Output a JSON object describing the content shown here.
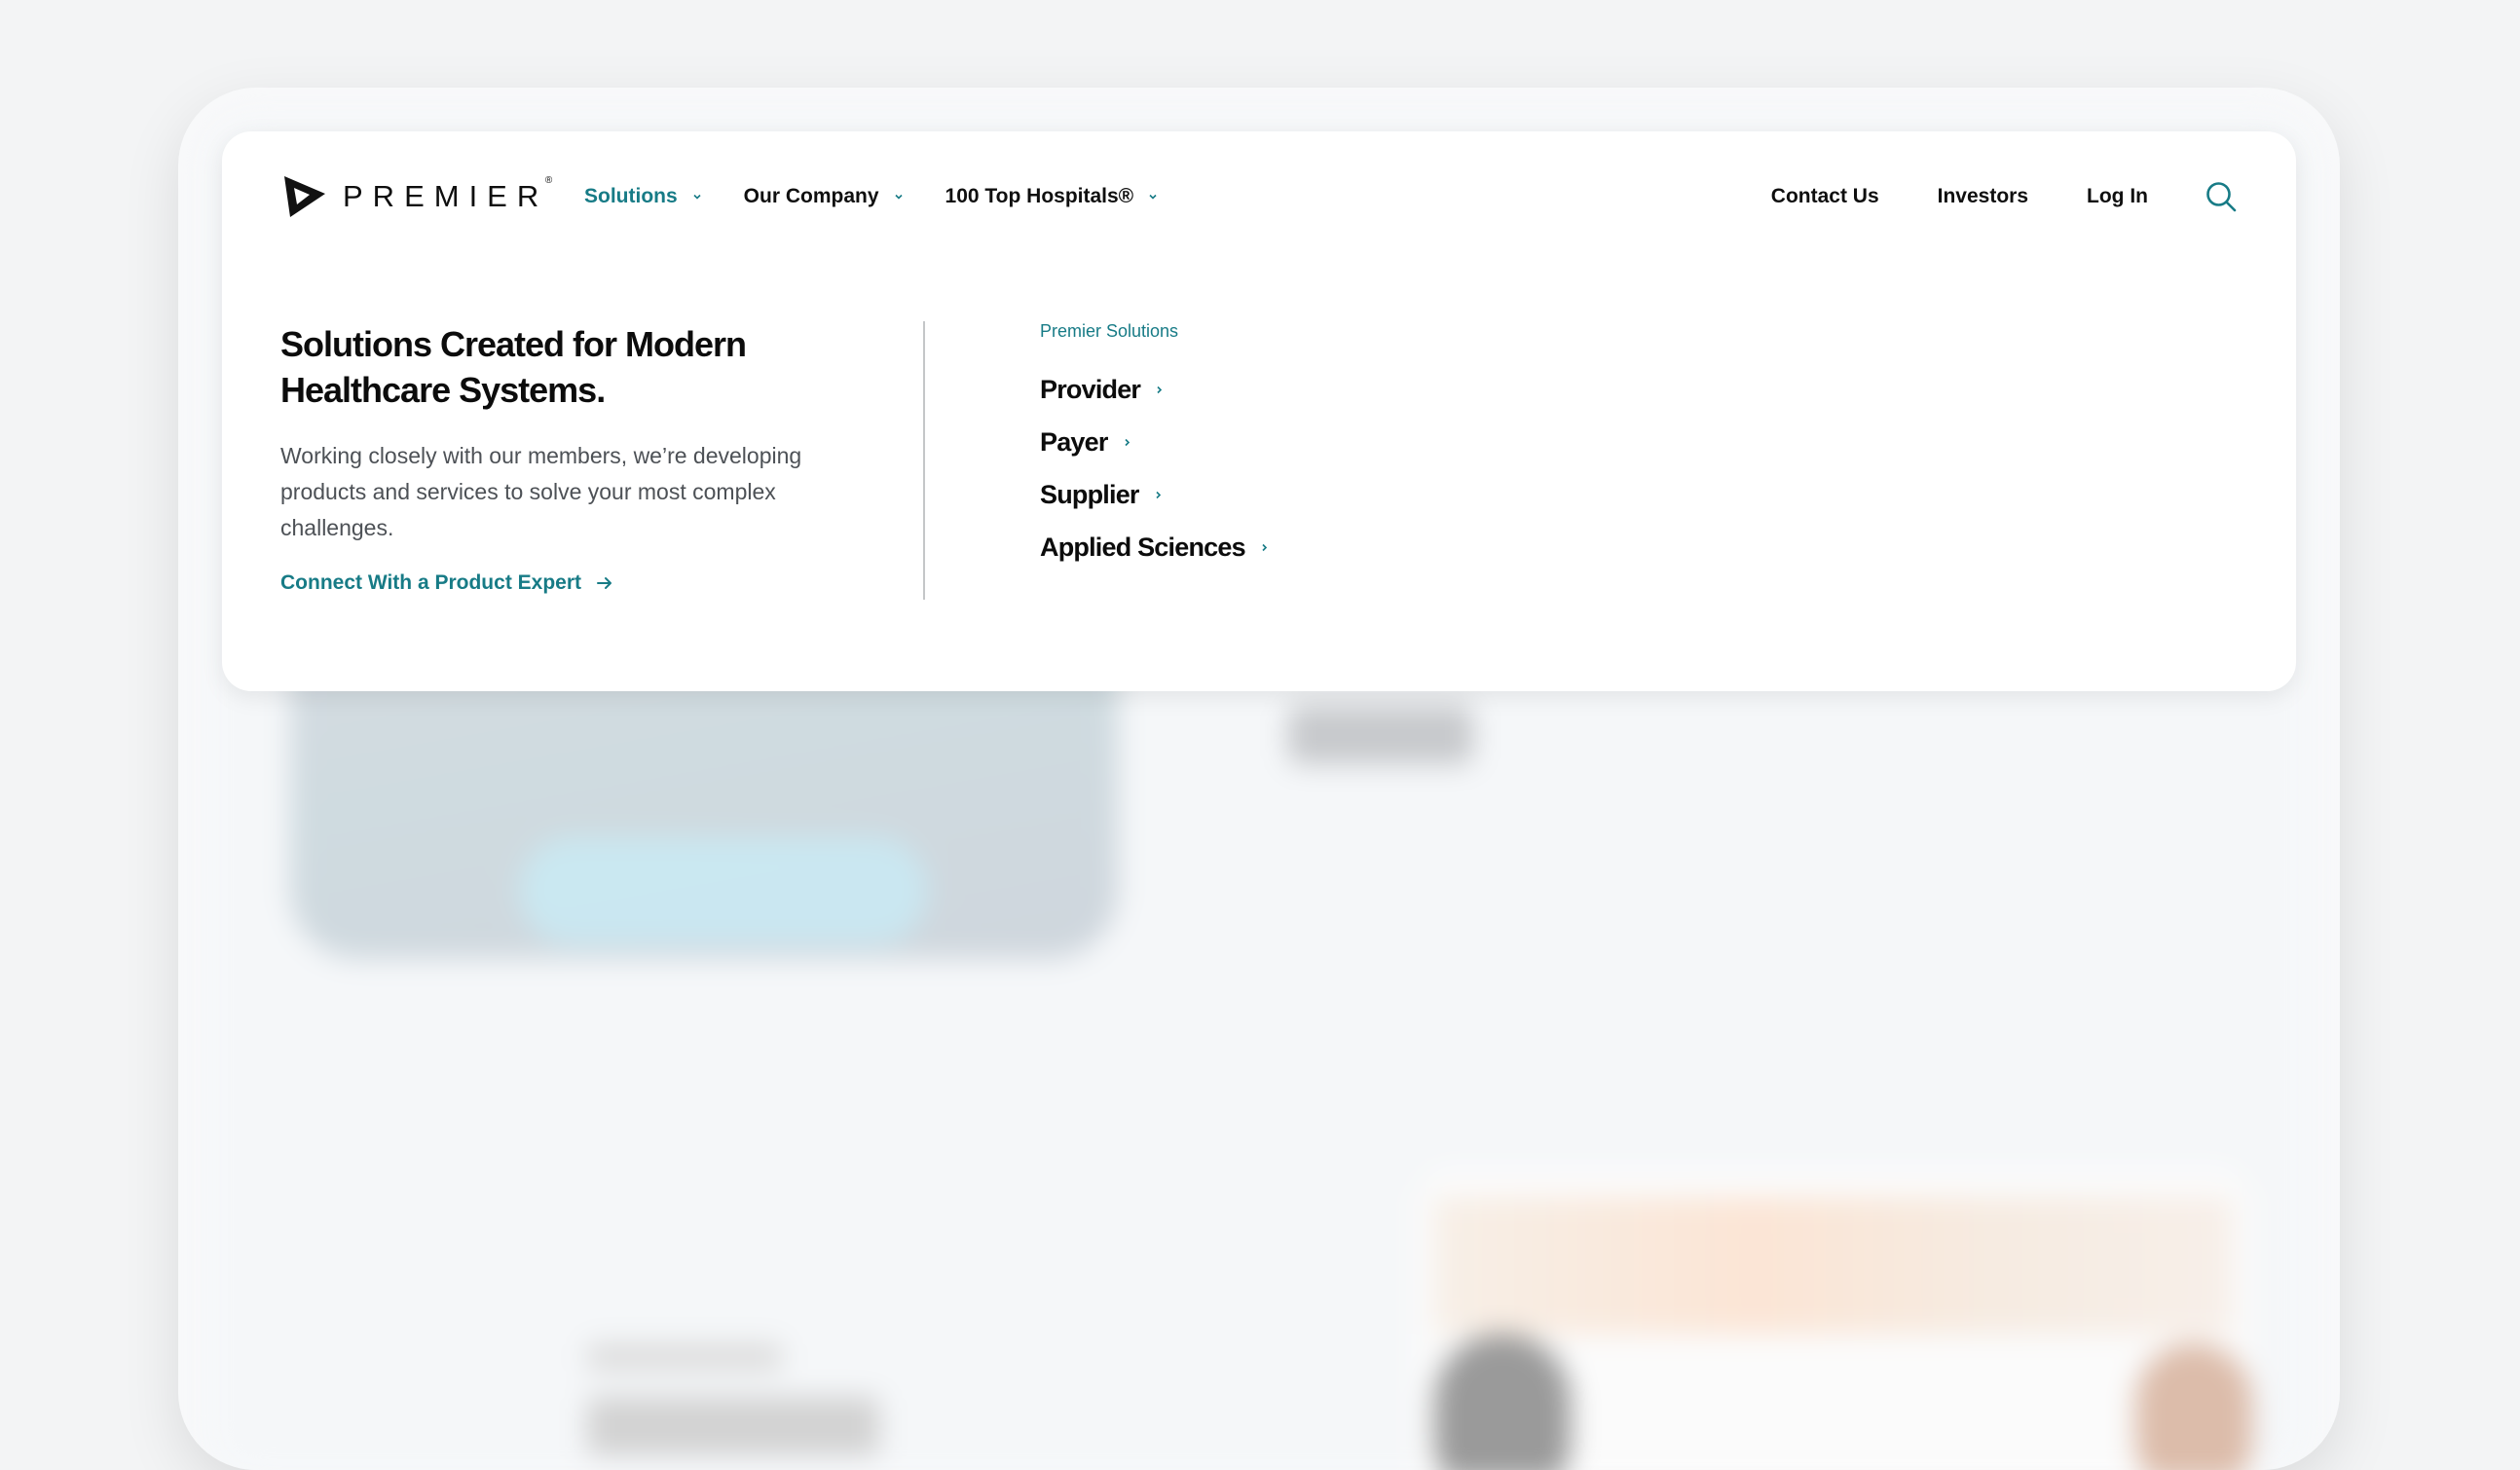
{
  "header": {
    "logo_text": "PREMIER",
    "logo_reg": "®",
    "main_nav": [
      {
        "label": "Solutions",
        "active": true
      },
      {
        "label": "Our Company",
        "active": false
      },
      {
        "label": "100 Top Hospitals®",
        "active": false
      }
    ],
    "utility_nav": [
      {
        "label": "Contact Us"
      },
      {
        "label": "Investors"
      },
      {
        "label": "Log In"
      }
    ],
    "search_icon": "search-icon"
  },
  "mega_menu": {
    "heading": "Solutions Created for Modern Healthcare Systems.",
    "description": "Working closely with our members, we’re developing products and services to solve your most complex challenges.",
    "cta_label": "Connect With a Product Expert",
    "section_label": "Premier Solutions",
    "links": [
      {
        "label": "Provider"
      },
      {
        "label": "Payer"
      },
      {
        "label": "Supplier"
      },
      {
        "label": "Applied Sciences"
      }
    ]
  },
  "colors": {
    "accent": "#177b86",
    "text": "#0c0c0c",
    "muted_text": "#4d5156",
    "page_background": "#f3f4f5",
    "panel_background": "#ffffff"
  }
}
